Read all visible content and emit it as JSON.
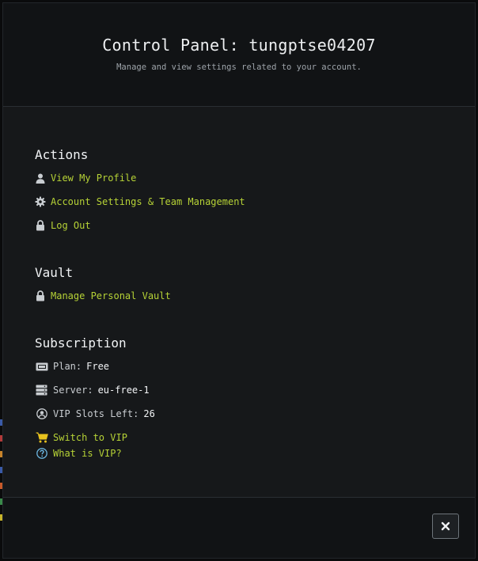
{
  "modal": {
    "title": "Control Panel: tungptse04207",
    "subtitle": "Manage and view settings related to your account."
  },
  "actions": {
    "title": "Actions",
    "items": [
      {
        "label": "View My Profile",
        "icon": "user-icon"
      },
      {
        "label": "Account Settings & Team Management",
        "icon": "gear-icon"
      },
      {
        "label": "Log Out",
        "icon": "lock-icon"
      }
    ]
  },
  "vault": {
    "title": "Vault",
    "items": [
      {
        "label": "Manage Personal Vault",
        "icon": "lock-icon"
      }
    ]
  },
  "subscription": {
    "title": "Subscription",
    "plan_label": "Plan:",
    "plan_value": "Free",
    "server_label": "Server:",
    "server_value": "eu-free-1",
    "slots_label": "VIP Slots Left:",
    "slots_value": "26",
    "switch_label": "Switch to VIP",
    "what_label": "What is VIP?"
  },
  "footer": {
    "close_icon": "close-icon"
  },
  "colors": {
    "accent": "#b6d236",
    "help": "#6bb5e0",
    "cart": "#e8c21e",
    "text": "#eef0f2",
    "muted": "#9ea4aa"
  }
}
